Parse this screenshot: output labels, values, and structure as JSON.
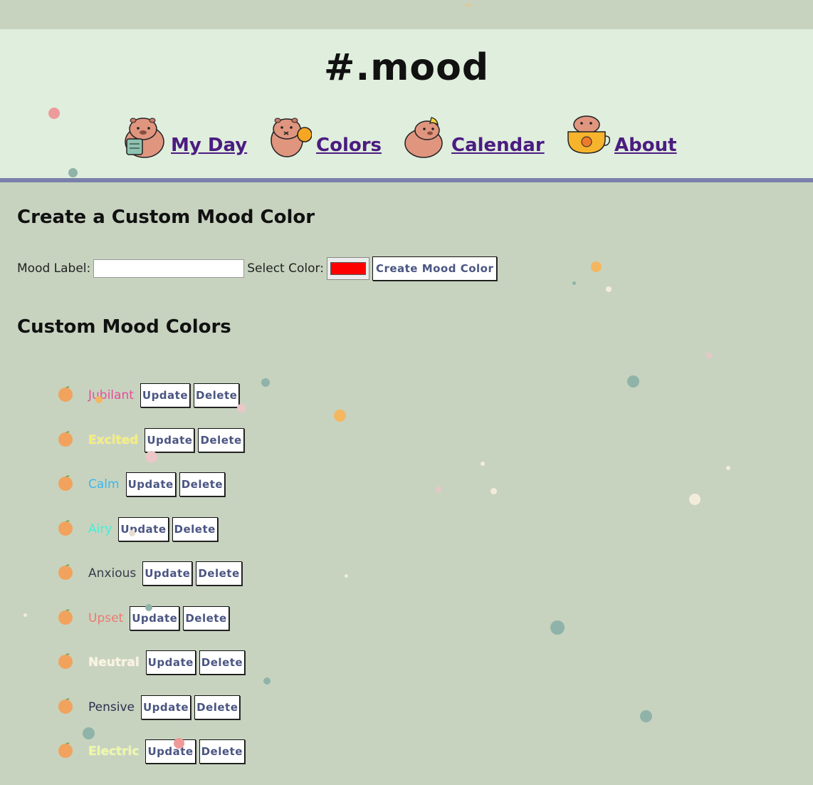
{
  "app": {
    "title": "#.mood"
  },
  "nav": [
    {
      "label": "My Day",
      "icon": "capybara-notebook-icon"
    },
    {
      "label": "Colors",
      "icon": "capybara-orange-icon"
    },
    {
      "label": "Calendar",
      "icon": "capybara-banana-icon"
    },
    {
      "label": "About",
      "icon": "capybara-cup-icon"
    }
  ],
  "create_section": {
    "heading": "Create a Custom Mood Color",
    "mood_label_text": "Mood Label:",
    "mood_label_value": "",
    "select_color_text": "Select Color:",
    "selected_color": "#ff0000",
    "create_button": "Create Mood Color"
  },
  "list_section": {
    "heading": "Custom Mood Colors",
    "update_label": "Update",
    "delete_label": "Delete",
    "items": [
      {
        "label": "Jubilant",
        "color": "#e84b9a"
      },
      {
        "label": "Excited",
        "color": "#f5ec7a"
      },
      {
        "label": "Calm",
        "color": "#38b8ef"
      },
      {
        "label": "Airy",
        "color": "#3ef0d8"
      },
      {
        "label": "Anxious",
        "color": "#3a3a4a"
      },
      {
        "label": "Upset",
        "color": "#ec7a70"
      },
      {
        "label": "Neutral",
        "color": "#fbf3df"
      },
      {
        "label": "Pensive",
        "color": "#2b3050"
      },
      {
        "label": "Electric",
        "color": "#eef7a4"
      }
    ]
  },
  "colors": {
    "page_bg": "#c7d3bf",
    "header_bg": "#e0eede",
    "header_border": "#7a80ab",
    "nav_link": "#4b1c80",
    "button_text": "#4a5582"
  }
}
